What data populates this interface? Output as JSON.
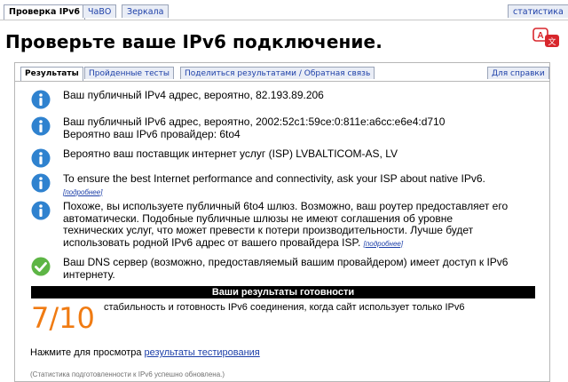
{
  "top_tabs": [
    {
      "label": "Проверка IPv6"
    },
    {
      "label": "ЧаВО"
    },
    {
      "label": "Зеркала"
    }
  ],
  "stats_tab": "статистика",
  "page_title": "Проверьте ваше IPv6 подключение.",
  "sub_tabs": [
    {
      "label": "Результаты"
    },
    {
      "label": "Пройденные тесты"
    },
    {
      "label": "Поделиться результатами / Обратная связь"
    }
  ],
  "help_tab": "Для справки",
  "results": [
    {
      "icon": "info-icon",
      "lines": [
        "Ваш публичный IPv4 адрес, вероятно, 82.193.89.206"
      ]
    },
    {
      "icon": "info-icon",
      "lines": [
        "Ваш публичный IPv6 адрес, вероятно, 2002:52c1:59ce:0:811e:a6cc:e6e4:d710",
        "Вероятно ваш IPv6 провайдер: 6to4"
      ]
    },
    {
      "icon": "info-icon",
      "lines": [
        "Вероятно ваш поставщик интернет услуг (ISP) LVBALTICOM-AS, LV"
      ]
    },
    {
      "icon": "info-icon",
      "lines": [
        "To ensure the best Internet performance and connectivity, ask your ISP about native IPv6."
      ],
      "more": "[подробнее]"
    },
    {
      "icon": "info-icon",
      "lines": [
        "Похоже, вы используете публичный 6to4 шлюз. Возможно, ваш роутер предоставляет его",
        "автоматически. Подобные публичные шлюзы не имеют соглашения об уровне",
        "технических услуг, что может превести к потери производительности. Лучше будет",
        "использовать родной IPv6 адрес от вашего провайдера ISP."
      ],
      "more": "[подробнее]"
    },
    {
      "icon": "check-icon",
      "lines": [
        "Ваш DNS сервер (возможно, предоставляемый вашим провайдером) имеет доступ к IPv6",
        "интернету."
      ]
    }
  ],
  "readiness_header": "Ваши результаты готовности",
  "score": "7/10",
  "score_desc": "стабильность и готовность IPv6 соединения, когда сайт использует только IPv6",
  "click_prefix": "Нажмите для просмотра ",
  "click_link": "результаты тестирования",
  "note": "(Статистика подготовленности к IPv6 успешно обновлена.)",
  "colors": {
    "info_blue": "#2f82cf",
    "check_green": "#5db545",
    "score_orange": "#f07b12",
    "link": "#1c3fa8"
  }
}
